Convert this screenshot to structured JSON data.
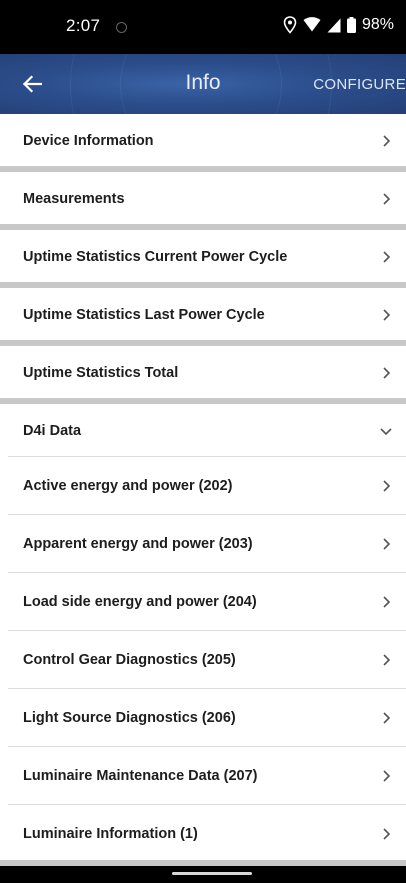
{
  "status_bar": {
    "time": "2:07",
    "battery": "98%",
    "icons": [
      "location-icon",
      "wifi-icon",
      "signal-icon",
      "battery-icon"
    ]
  },
  "app_bar": {
    "title": "Info",
    "action_label": "CONFIGURE",
    "back_icon": "arrow-back-icon"
  },
  "colors": {
    "app_bar": "#2c4e8c",
    "text": "#1d1d1d",
    "separator": "#c8c8c8"
  },
  "items": [
    {
      "label": "Device Information",
      "state": "collapsed"
    },
    {
      "label": "Measurements",
      "state": "collapsed"
    },
    {
      "label": "Uptime Statistics Current Power Cycle",
      "state": "collapsed"
    },
    {
      "label": "Uptime Statistics Last Power Cycle",
      "state": "collapsed"
    },
    {
      "label": "Uptime Statistics Total",
      "state": "collapsed"
    },
    {
      "label": "D4i Data",
      "state": "expanded"
    },
    {
      "label": "Active energy and power (202)",
      "state": "collapsed"
    },
    {
      "label": "Apparent energy and power (203)",
      "state": "collapsed"
    },
    {
      "label": "Load side energy and power (204)",
      "state": "collapsed"
    },
    {
      "label": "Control Gear Diagnostics (205)",
      "state": "collapsed"
    },
    {
      "label": "Light Source Diagnostics (206)",
      "state": "collapsed"
    },
    {
      "label": "Luminaire Maintenance Data (207)",
      "state": "collapsed"
    },
    {
      "label": "Luminaire Information (1)",
      "state": "collapsed"
    }
  ]
}
